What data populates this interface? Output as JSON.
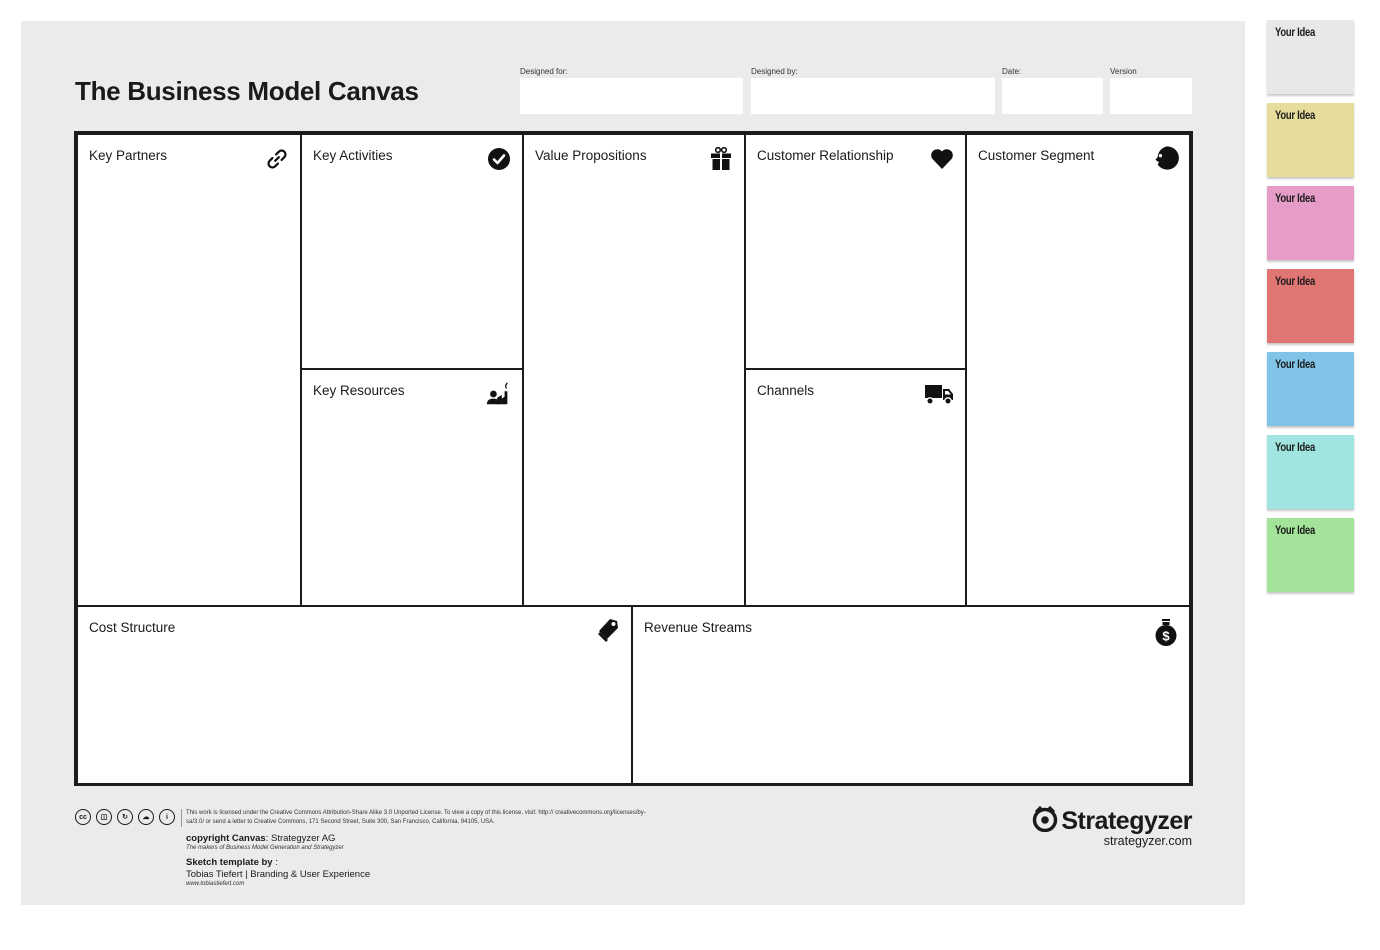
{
  "title": "The Business Model Canvas",
  "meta_fields": [
    {
      "label": "Designed for:",
      "value": ""
    },
    {
      "label": "Designed by:",
      "value": ""
    },
    {
      "label": "Date:",
      "value": ""
    },
    {
      "label": "Version",
      "value": ""
    }
  ],
  "blocks": {
    "key_partners": {
      "label": "Key Partners",
      "icon": "link-icon"
    },
    "key_activities": {
      "label": "Key Activities",
      "icon": "check-circle-icon"
    },
    "key_resources": {
      "label": "Key Resources",
      "icon": "worker-factory-icon"
    },
    "value_propositions": {
      "label": "Value Propositions",
      "icon": "gift-icon"
    },
    "customer_relationship": {
      "label": "Customer Relationship",
      "icon": "heart-icon"
    },
    "channels": {
      "label": "Channels",
      "icon": "truck-icon"
    },
    "customer_segment": {
      "label": "Customer Segment",
      "icon": "face-icon"
    },
    "cost_structure": {
      "label": "Cost Structure",
      "icon": "price-tags-icon"
    },
    "revenue_streams": {
      "label": "Revenue Streams",
      "icon": "money-bag-icon"
    }
  },
  "footer": {
    "cc_icons": [
      "cc",
      "by-nc",
      "sa",
      "nc",
      "by"
    ],
    "license_text": "This work is licensed under the Creative Commons Attribution-Share Alike 3.0 Unported License. To view a copy of this license, visit: http:// creativecommons.org/licenses/by-sa/3.0/ or send a letter to Creative Commons, 171 Second Street, Suite 300, San Francisco, California, 94105, USA.",
    "copyright_label": "copyright Canvas",
    "copyright_value": ": Strategyzer AG",
    "makers_text": "The makers of Business Model Generation and Strategyzer",
    "sketch_label": "Sketch template by",
    "sketch_suffix": " :",
    "author": "Tobias Tiefert | Branding & User Experience",
    "author_url": "www.tobiastiefert.com"
  },
  "brand": {
    "name": "Strategyzer",
    "url": "strategyzer.com"
  },
  "sticky_notes": [
    {
      "label": "Your Idea",
      "color": "#e8e8e6"
    },
    {
      "label": "Your Idea",
      "color": "#e6dd9c"
    },
    {
      "label": "Your Idea",
      "color": "#e59cc7"
    },
    {
      "label": "Your Idea",
      "color": "#e07674"
    },
    {
      "label": "Your Idea",
      "color": "#81c4e8"
    },
    {
      "label": "Your Idea",
      "color": "#a0e5df"
    },
    {
      "label": "Your Idea",
      "color": "#a3e39a"
    }
  ]
}
